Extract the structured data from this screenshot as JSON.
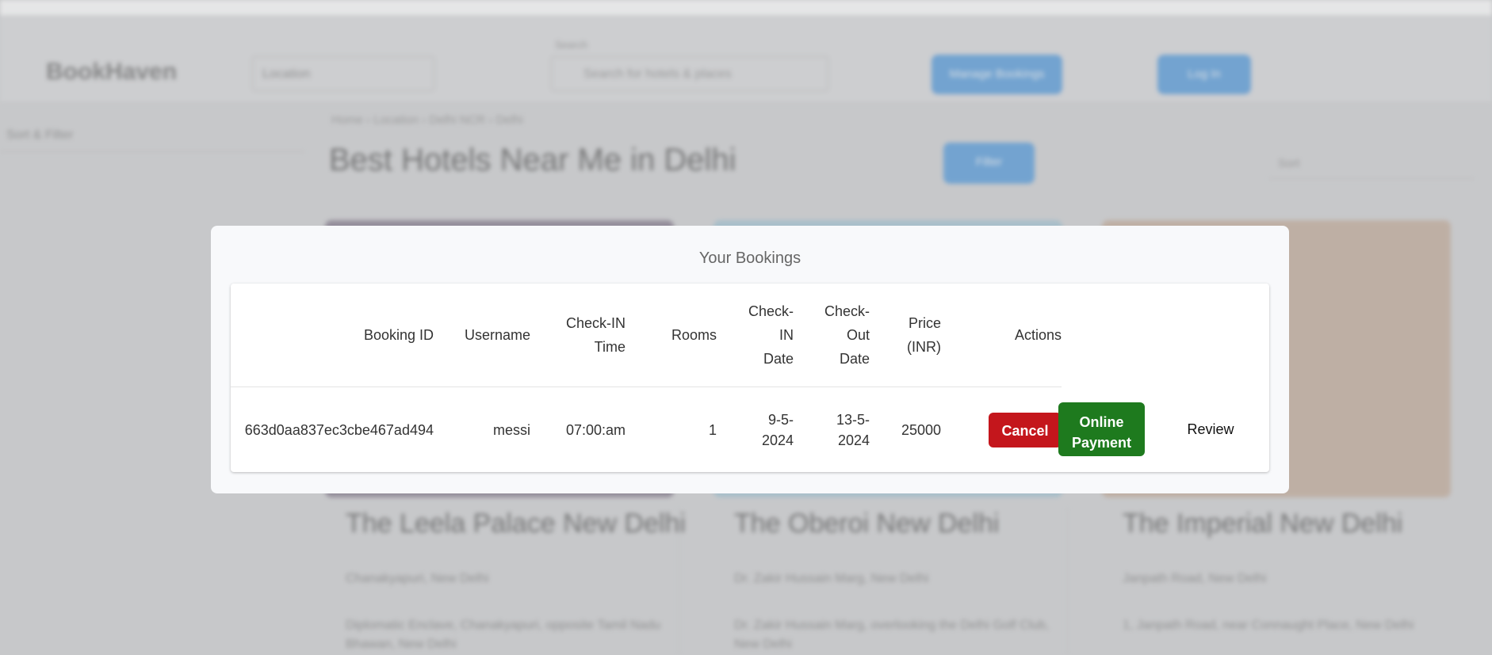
{
  "background": {
    "brand": "BookHaven",
    "location_select": "Location",
    "search_label": "Search",
    "search_placeholder": "Search for hotels & places",
    "header_button_1": "Manage Bookings",
    "header_button_2": "Log In",
    "sort_filter": "Sort & Filter",
    "breadcrumbs": "Home  ›  Location  ›  Delhi NCR  ›  Delhi",
    "page_heading": "Best Hotels Near Me in Delhi",
    "page_button": "Filter",
    "sort_select": "Sort",
    "cards": [
      {
        "title": "The Leela Palace New Delhi",
        "subtitle": "Chanakyapuri, New Delhi",
        "text": "Diplomatic Enclave, Chanakyapuri, opposite Tamil Nadu Bhawan, New Delhi"
      },
      {
        "title": "The Oberoi New Delhi",
        "subtitle": "Dr. Zakir Hussain Marg, New Delhi",
        "text": "Dr. Zakir Hussain Marg, overlooking the Delhi Golf Club, New Delhi"
      },
      {
        "title": "The Imperial New Delhi",
        "subtitle": "Janpath Road, New Delhi",
        "text": "1, Janpath Road, near Connaught Place, New Delhi"
      }
    ]
  },
  "modal": {
    "title": "Your Bookings",
    "columns": [
      {
        "lines": [
          "Booking ID"
        ]
      },
      {
        "lines": [
          "Username"
        ]
      },
      {
        "lines": [
          "Check-IN",
          "Time"
        ]
      },
      {
        "lines": [
          "Rooms"
        ]
      },
      {
        "lines": [
          "Check-",
          "IN",
          "Date"
        ]
      },
      {
        "lines": [
          "Check-",
          "Out",
          "Date"
        ]
      },
      {
        "lines": [
          "Price",
          "(INR)"
        ]
      },
      {
        "lines": [
          "Actions"
        ]
      }
    ],
    "rows": [
      {
        "booking_id": "663d0aa837ec3cbe467ad494",
        "username": "messi",
        "checkin_time": "07:00:am",
        "rooms": "1",
        "checkin_date": [
          "9-5-",
          "2024"
        ],
        "checkout_date": [
          "13-5-",
          "2024"
        ],
        "price": "25000",
        "cancel_label": "Cancel",
        "payment_label": [
          "Online",
          "Payment"
        ],
        "review_label": "Review"
      }
    ]
  },
  "colors": {
    "cancel": "#c4161c",
    "payment": "#1e7a1e",
    "accent": "#2f86d6"
  }
}
